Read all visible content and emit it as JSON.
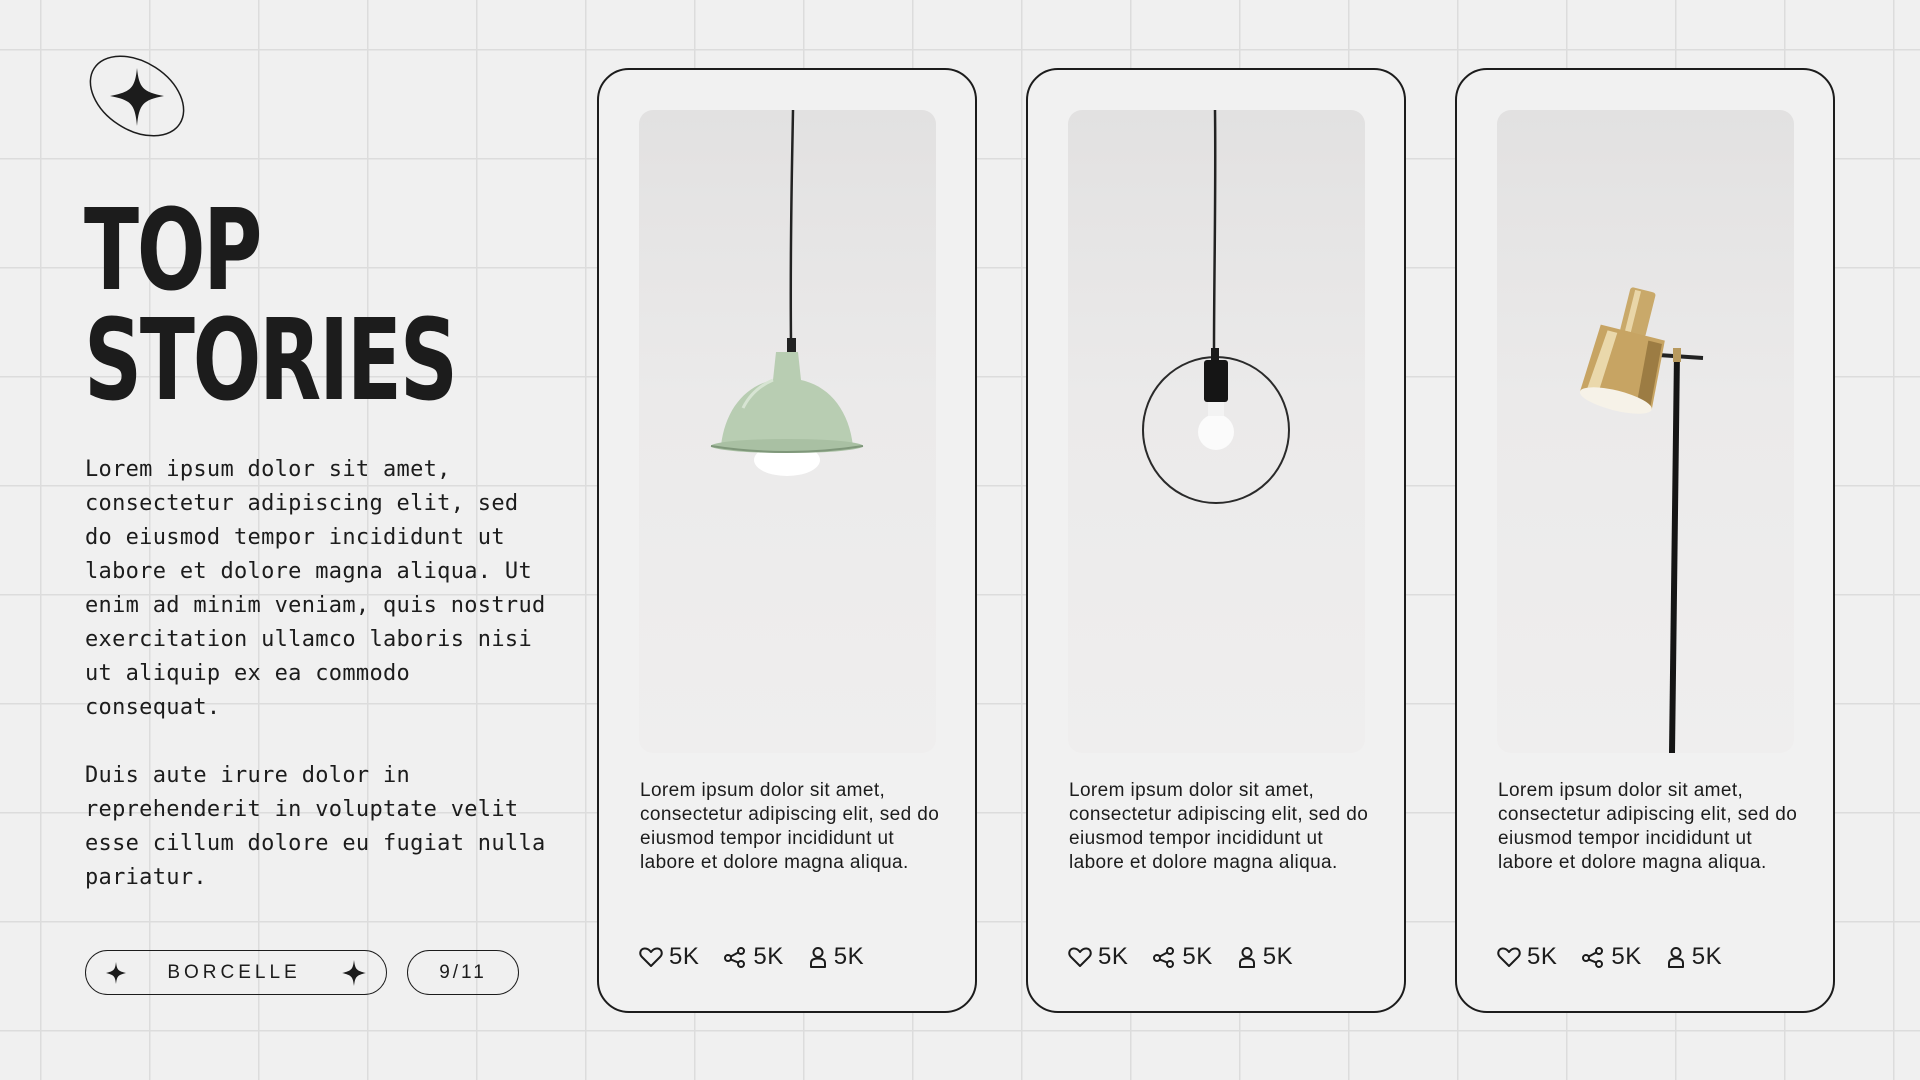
{
  "page": {
    "title_lines": [
      "TOP",
      "STORIES"
    ],
    "intro_paragraphs": [
      "Lorem ipsum dolor sit amet, consectetur adipiscing elit, sed do eiusmod tempor incididunt ut labore et dolore magna aliqua. Ut enim ad minim veniam, quis nostrud exercitation ullamco laboris nisi ut aliquip ex ea commodo consequat.",
      "Duis aute irure dolor in reprehenderit in voluptate velit esse cillum dolore eu fugiat nulla pariatur."
    ],
    "brand": "BORCELLE",
    "page_indicator": "9/11"
  },
  "cards": [
    {
      "image": "green-pendant-lamp",
      "description": "Lorem ipsum dolor sit amet, consectetur adipiscing elit, sed do eiusmod tempor incididunt ut labore et dolore magna aliqua.",
      "likes": "5K",
      "shares": "5K",
      "followers": "5K"
    },
    {
      "image": "ring-pendant-lamp",
      "description": "Lorem ipsum dolor sit amet, consectetur adipiscing elit, sed do eiusmod tempor incididunt ut labore et dolore magna aliqua.",
      "likes": "5K",
      "shares": "5K",
      "followers": "5K"
    },
    {
      "image": "brass-floor-lamp",
      "description": "Lorem ipsum dolor sit amet, consectetur adipiscing elit, sed do eiusmod tempor incididunt ut labore et dolore magna aliqua.",
      "likes": "5K",
      "shares": "5K",
      "followers": "5K"
    }
  ],
  "icons": {
    "logo": "four-point-star-in-ellipse-icon",
    "brand_decor": "four-point-star-icon",
    "likes": "heart-icon",
    "shares": "share-icon",
    "followers": "user-icon"
  },
  "colors": {
    "background": "#f0f0f0",
    "grid": "#dcdcdc",
    "ink": "#1c1c1c",
    "lamp_green": "#b8cdb2",
    "lamp_brass": "#c9a96a"
  }
}
